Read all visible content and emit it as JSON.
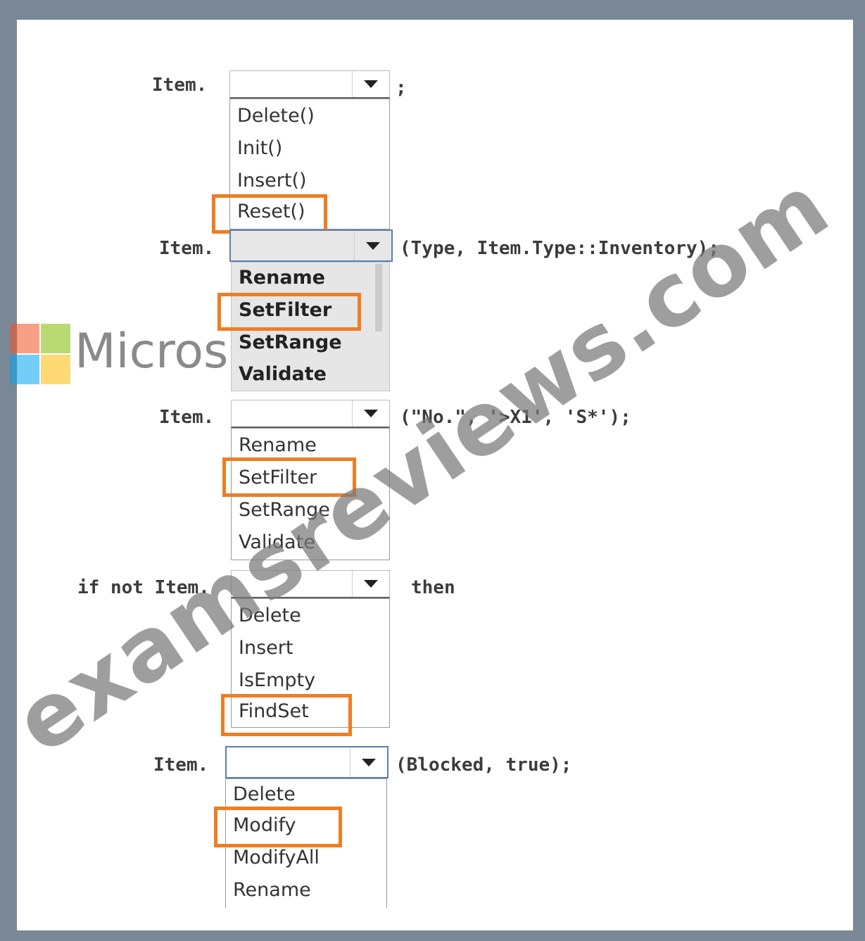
{
  "blocks": [
    {
      "prefix": "Item.",
      "suffix": ";",
      "options": [
        "Delete()",
        "Init()",
        "Insert()",
        "Reset()"
      ],
      "highlighted": "Reset()"
    },
    {
      "prefix": "Item.",
      "suffix": "(Type, Item.Type::Inventory);",
      "options": [
        "Rename",
        "SetFilter",
        "SetRange",
        "Validate"
      ],
      "highlighted": "SetFilter"
    },
    {
      "prefix": "Item.",
      "suffix": "(\"No.\", '>X1', 'S*');",
      "options": [
        "Rename",
        "SetFilter",
        "SetRange",
        "Validate"
      ],
      "highlighted": "SetFilter"
    },
    {
      "prefix": "if not Item.",
      "suffix": "then",
      "options": [
        "Delete",
        "Insert",
        "IsEmpty",
        "FindSet"
      ],
      "highlighted": "FindSet"
    },
    {
      "prefix": "Item.",
      "suffix": "(Blocked, true);",
      "options": [
        "Delete",
        "Modify",
        "ModifyAll",
        "Rename"
      ],
      "highlighted": "Modify"
    }
  ],
  "branding": {
    "logo_text": "Microsoft",
    "logo_colors": [
      "#f25022",
      "#7fba00",
      "#00a4ef",
      "#ffb900"
    ],
    "watermark": "examsreviews.com"
  },
  "colors": {
    "highlight": "#ef7d22",
    "frame": "#7a8797"
  }
}
